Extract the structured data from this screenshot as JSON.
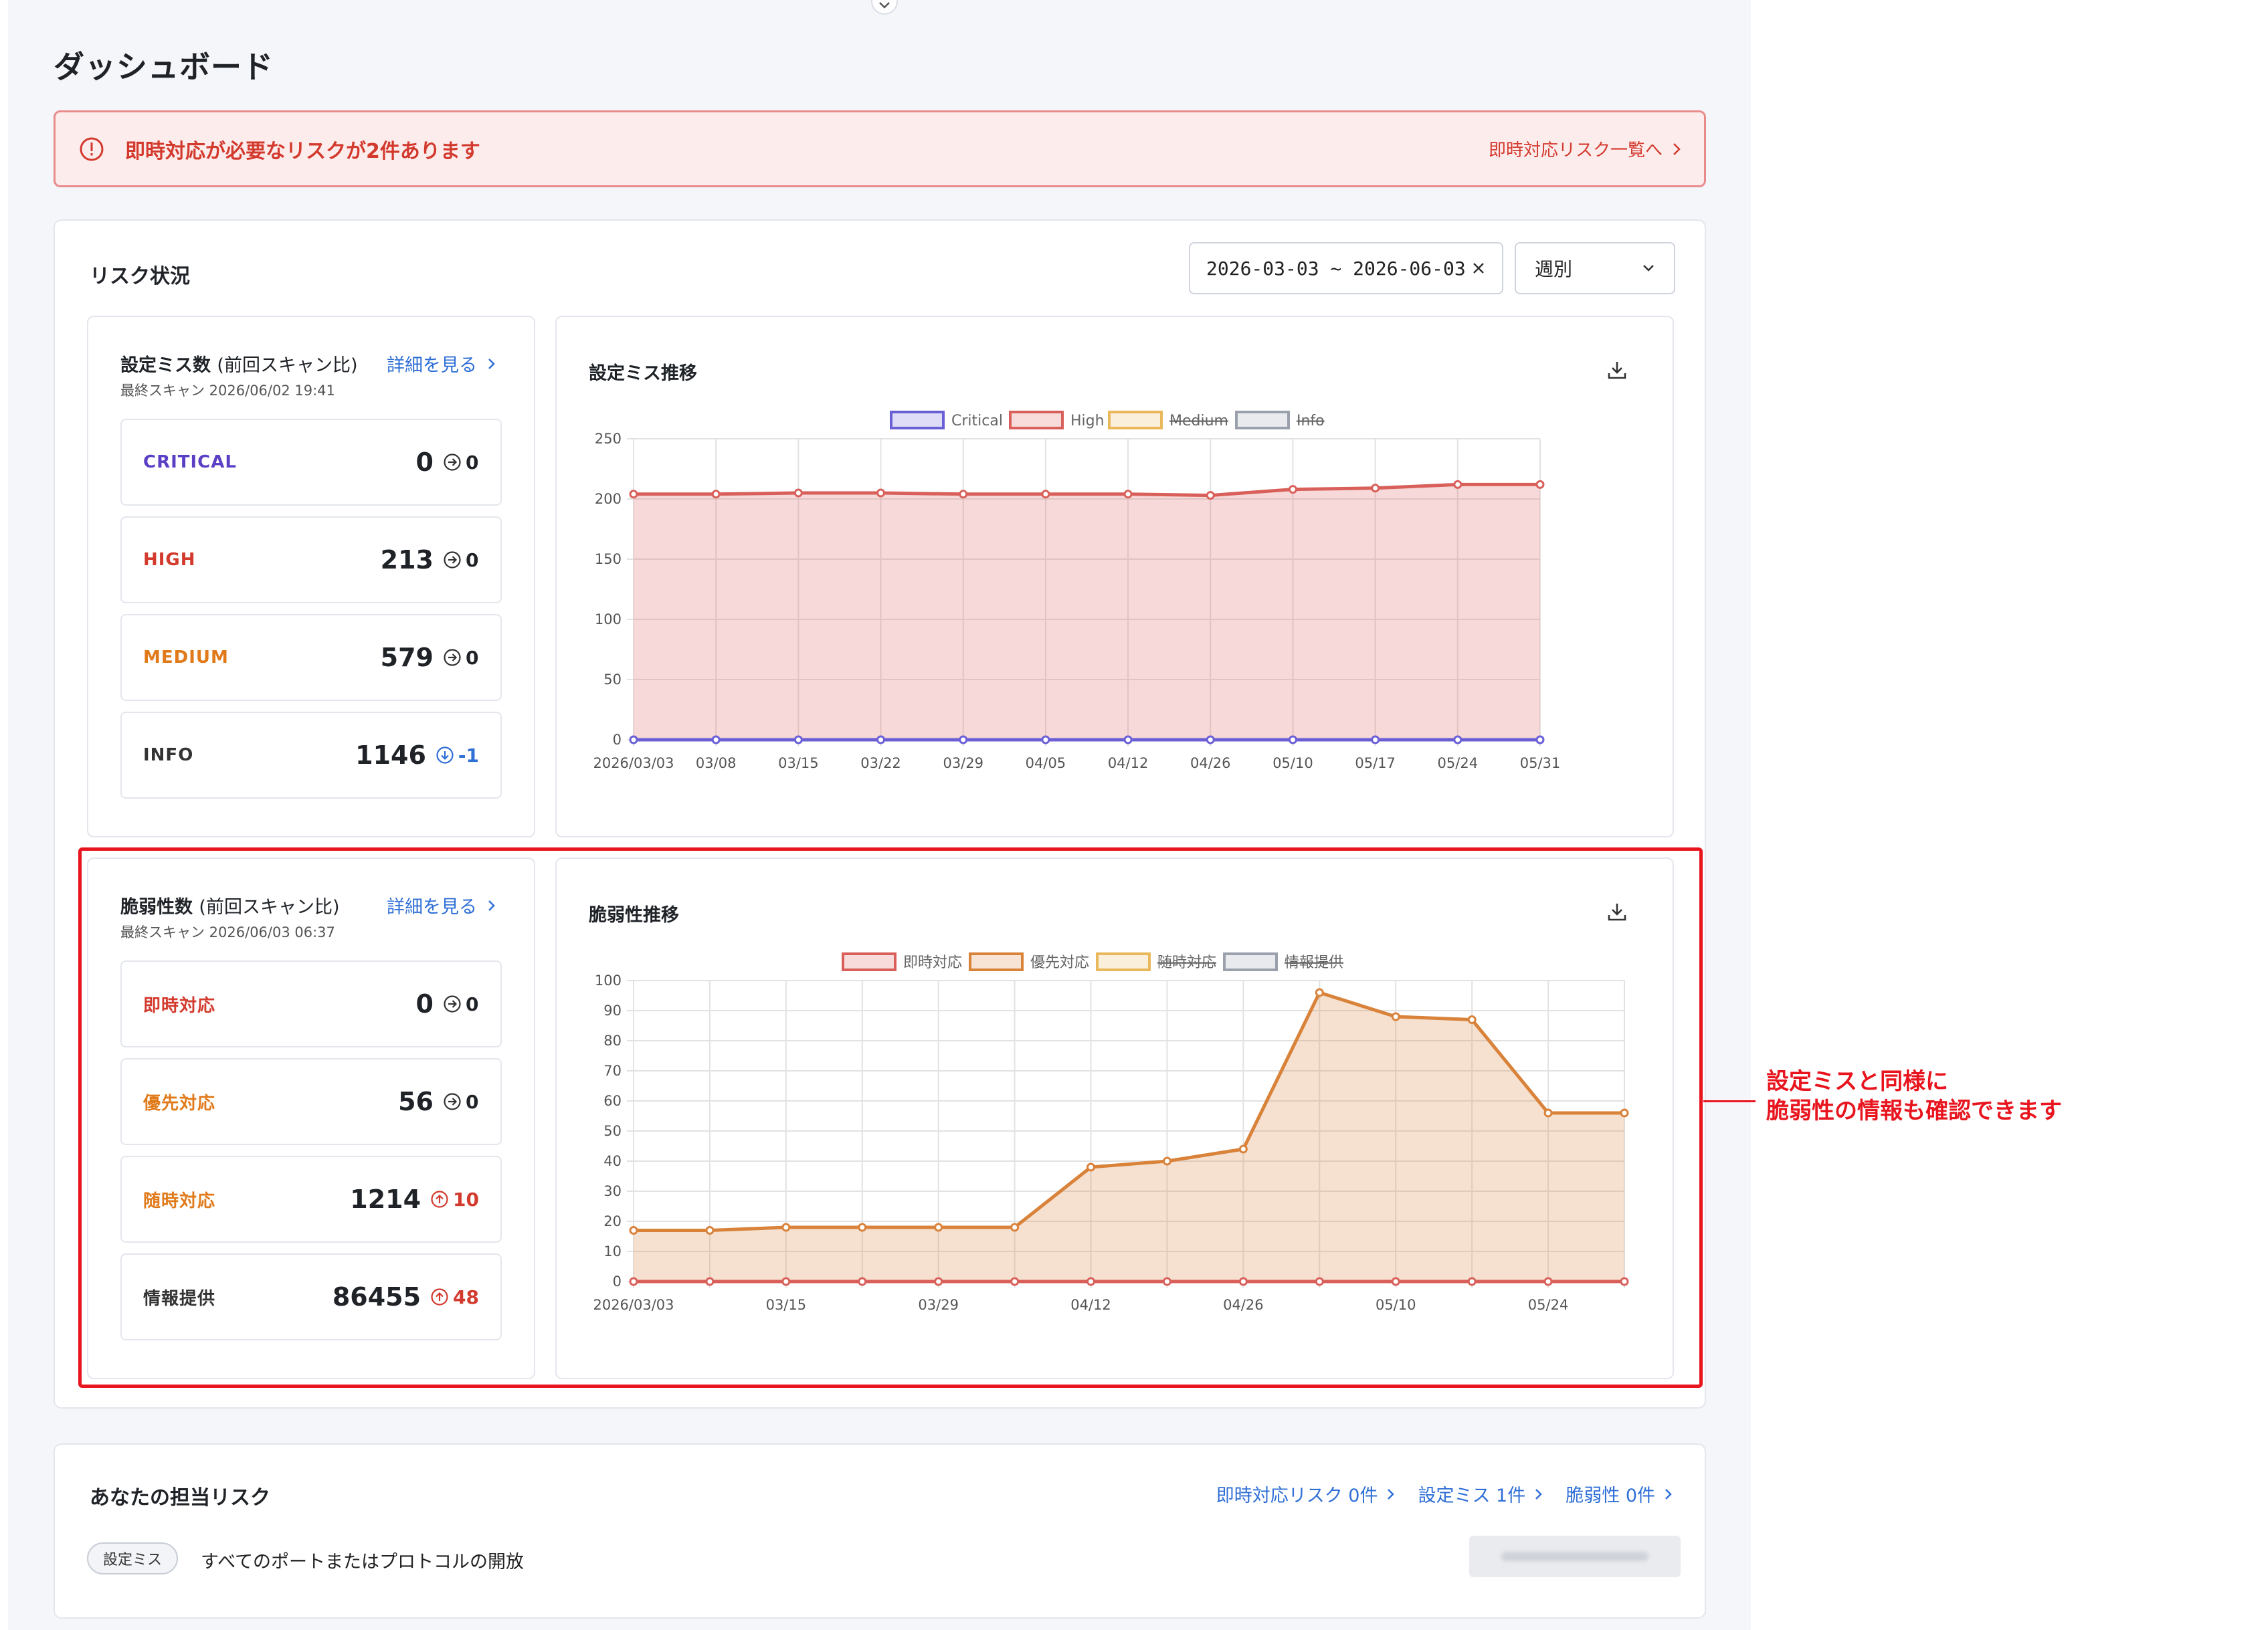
{
  "page": {
    "title": "ダッシュボード"
  },
  "alert": {
    "message": "即時対応が必要なリスクが2件あります",
    "link_label": "即時対応リスク一覧へ"
  },
  "risk_status": {
    "title": "リスク状況",
    "date_range": "2026-03-03 ~ 2026-06-03",
    "period": "週別"
  },
  "misconfig_summary": {
    "title": "設定ミス数",
    "title_suffix": "(前回スキャン比)",
    "last_scan": "最終スキャン 2026/06/02 19:41",
    "detail_label": "詳細を見る",
    "items": [
      {
        "label": "CRITICAL",
        "count": "0",
        "delta": "0",
        "trend": "flat",
        "color": "#5b3fc4"
      },
      {
        "label": "HIGH",
        "count": "213",
        "delta": "0",
        "trend": "flat",
        "color": "#d33a2e"
      },
      {
        "label": "MEDIUM",
        "count": "579",
        "delta": "0",
        "trend": "flat",
        "color": "#e07a1a"
      },
      {
        "label": "INFO",
        "count": "1146",
        "delta": "-1",
        "trend": "down",
        "color": "#333333"
      }
    ]
  },
  "vuln_summary": {
    "title": "脆弱性数",
    "title_suffix": "(前回スキャン比)",
    "last_scan": "最終スキャン 2026/06/03 06:37",
    "detail_label": "詳細を見る",
    "items": [
      {
        "label": "即時対応",
        "count": "0",
        "delta": "0",
        "trend": "flat",
        "color": "#d33a2e"
      },
      {
        "label": "優先対応",
        "count": "56",
        "delta": "0",
        "trend": "flat",
        "color": "#e07a1a"
      },
      {
        "label": "随時対応",
        "count": "1214",
        "delta": "10",
        "trend": "up",
        "color": "#e07a1a"
      },
      {
        "label": "情報提供",
        "count": "86455",
        "delta": "48",
        "trend": "up",
        "color": "#333333"
      }
    ]
  },
  "misconfig_chart": {
    "title": "設定ミス推移",
    "chart_data": {
      "type": "area",
      "x": [
        "2026/03/03",
        "03/08",
        "03/15",
        "03/22",
        "03/29",
        "04/05",
        "04/12",
        "04/26",
        "05/10",
        "05/17",
        "05/24",
        "05/31"
      ],
      "ylim": [
        0,
        250
      ],
      "yticks": [
        0,
        50,
        100,
        150,
        200,
        250
      ],
      "grid": true,
      "legend": "top",
      "series": [
        {
          "name": "Critical",
          "values": [
            0,
            0,
            0,
            0,
            0,
            0,
            0,
            0,
            0,
            0,
            0,
            0
          ],
          "color": "#6b5fd6",
          "fill": false,
          "hidden": false
        },
        {
          "name": "High",
          "values": [
            204,
            204,
            205,
            205,
            204,
            204,
            204,
            203,
            208,
            209,
            212,
            212
          ],
          "color": "#d9605a",
          "fill": true,
          "hidden": false
        },
        {
          "name": "Medium",
          "values": [],
          "color": "#e9b85a",
          "fill": false,
          "hidden": true
        },
        {
          "name": "Info",
          "values": [],
          "color": "#9aa1ad",
          "fill": false,
          "hidden": true
        }
      ]
    }
  },
  "vuln_chart": {
    "title": "脆弱性推移",
    "chart_data": {
      "type": "area",
      "x": [
        "2026/03/03",
        "",
        "03/15",
        "",
        "03/29",
        "",
        "04/12",
        "",
        "04/26",
        "",
        "05/10",
        "",
        "05/24",
        ""
      ],
      "ylim": [
        0,
        100
      ],
      "yticks": [
        0,
        10,
        20,
        30,
        40,
        50,
        60,
        70,
        80,
        90,
        100
      ],
      "grid": true,
      "legend": "top",
      "series": [
        {
          "name": "即時対応",
          "values": [
            0,
            0,
            0,
            0,
            0,
            0,
            0,
            0,
            0,
            0,
            0,
            0,
            0,
            0
          ],
          "color": "#d9605a",
          "fill": false,
          "hidden": false
        },
        {
          "name": "優先対応",
          "values": [
            17,
            17,
            18,
            18,
            18,
            18,
            38,
            40,
            44,
            96,
            88,
            87,
            56,
            56
          ],
          "color": "#d9823a",
          "fill": true,
          "hidden": false
        },
        {
          "name": "随時対応",
          "values": [],
          "color": "#e9b85a",
          "fill": false,
          "hidden": true
        },
        {
          "name": "情報提供",
          "values": [],
          "color": "#9aa1ad",
          "fill": false,
          "hidden": true
        }
      ]
    }
  },
  "assigned": {
    "title": "あなたの担当リスク",
    "links": [
      "即時対応リスク 0件",
      "設定ミス 1件",
      "脆弱性 0件"
    ],
    "item_tag": "設定ミス",
    "item_text": "すべてのポートまたはプロトコルの開放"
  },
  "annotation": {
    "line1": "設定ミスと同様に",
    "line2": "脆弱性の情報も確認できます"
  }
}
